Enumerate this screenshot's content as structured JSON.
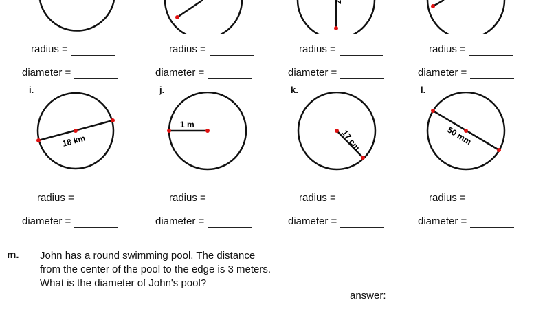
{
  "row1": {
    "circles": [
      {
        "radius_label": "radius =",
        "diameter_label": "diameter ="
      },
      {
        "radius_label": "radius =",
        "diameter_label": "diameter ="
      },
      {
        "radius_label": "radius =",
        "diameter_label": "diameter ="
      },
      {
        "radius_label": "radius =",
        "diameter_label": "diameter ="
      }
    ]
  },
  "row2": {
    "circles": [
      {
        "letter": "i.",
        "measure": "18 km",
        "radius_label": "radius =",
        "diameter_label": "diameter ="
      },
      {
        "letter": "j.",
        "measure": "1 m",
        "radius_label": "radius =",
        "diameter_label": "diameter ="
      },
      {
        "letter": "k.",
        "measure": "17 cm",
        "radius_label": "radius =",
        "diameter_label": "diameter ="
      },
      {
        "letter": "l.",
        "measure": "50 mm",
        "radius_label": "radius =",
        "diameter_label": "diameter ="
      }
    ]
  },
  "question": {
    "label": "m.",
    "lines": [
      "John has a round swimming pool.  The distance",
      "from the center of the pool to the edge is 3 meters.",
      "What is the diameter of John's pool?"
    ],
    "answer_label": "answer:"
  },
  "colors": {
    "point": "#e01010",
    "stroke": "#111111"
  }
}
